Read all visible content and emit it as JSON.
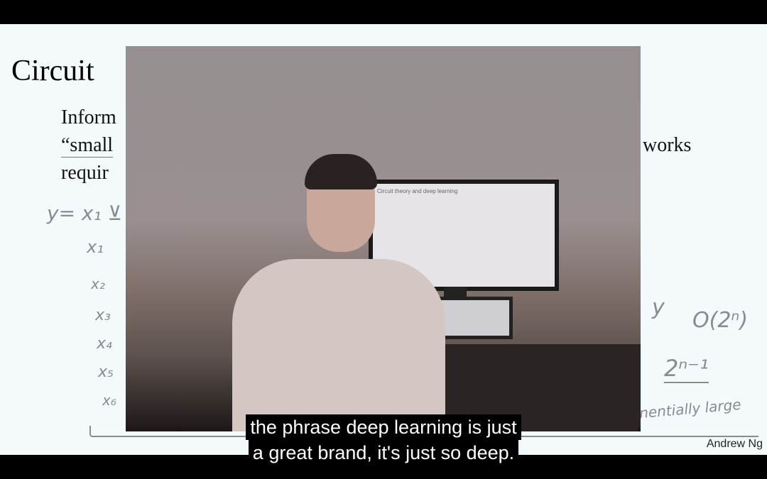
{
  "slide": {
    "title": "Circuit",
    "lines": [
      "Inform",
      "“small",
      "requir"
    ],
    "right_fragment": "works",
    "author": "Andrew Ng",
    "handwriting": {
      "left": [
        "y= x₁ ⊻",
        "x₁",
        "x₂",
        "x₃",
        "x₄",
        "x₅",
        "x₆"
      ],
      "right": [
        "y",
        "O(2ⁿ)",
        "2ⁿ⁻¹",
        "nentially large"
      ]
    }
  },
  "video": {
    "monitor_text": "Circuit theory and deep learning"
  },
  "subtitles": [
    "the phrase deep learning is just",
    "a great brand, it's just so deep."
  ]
}
